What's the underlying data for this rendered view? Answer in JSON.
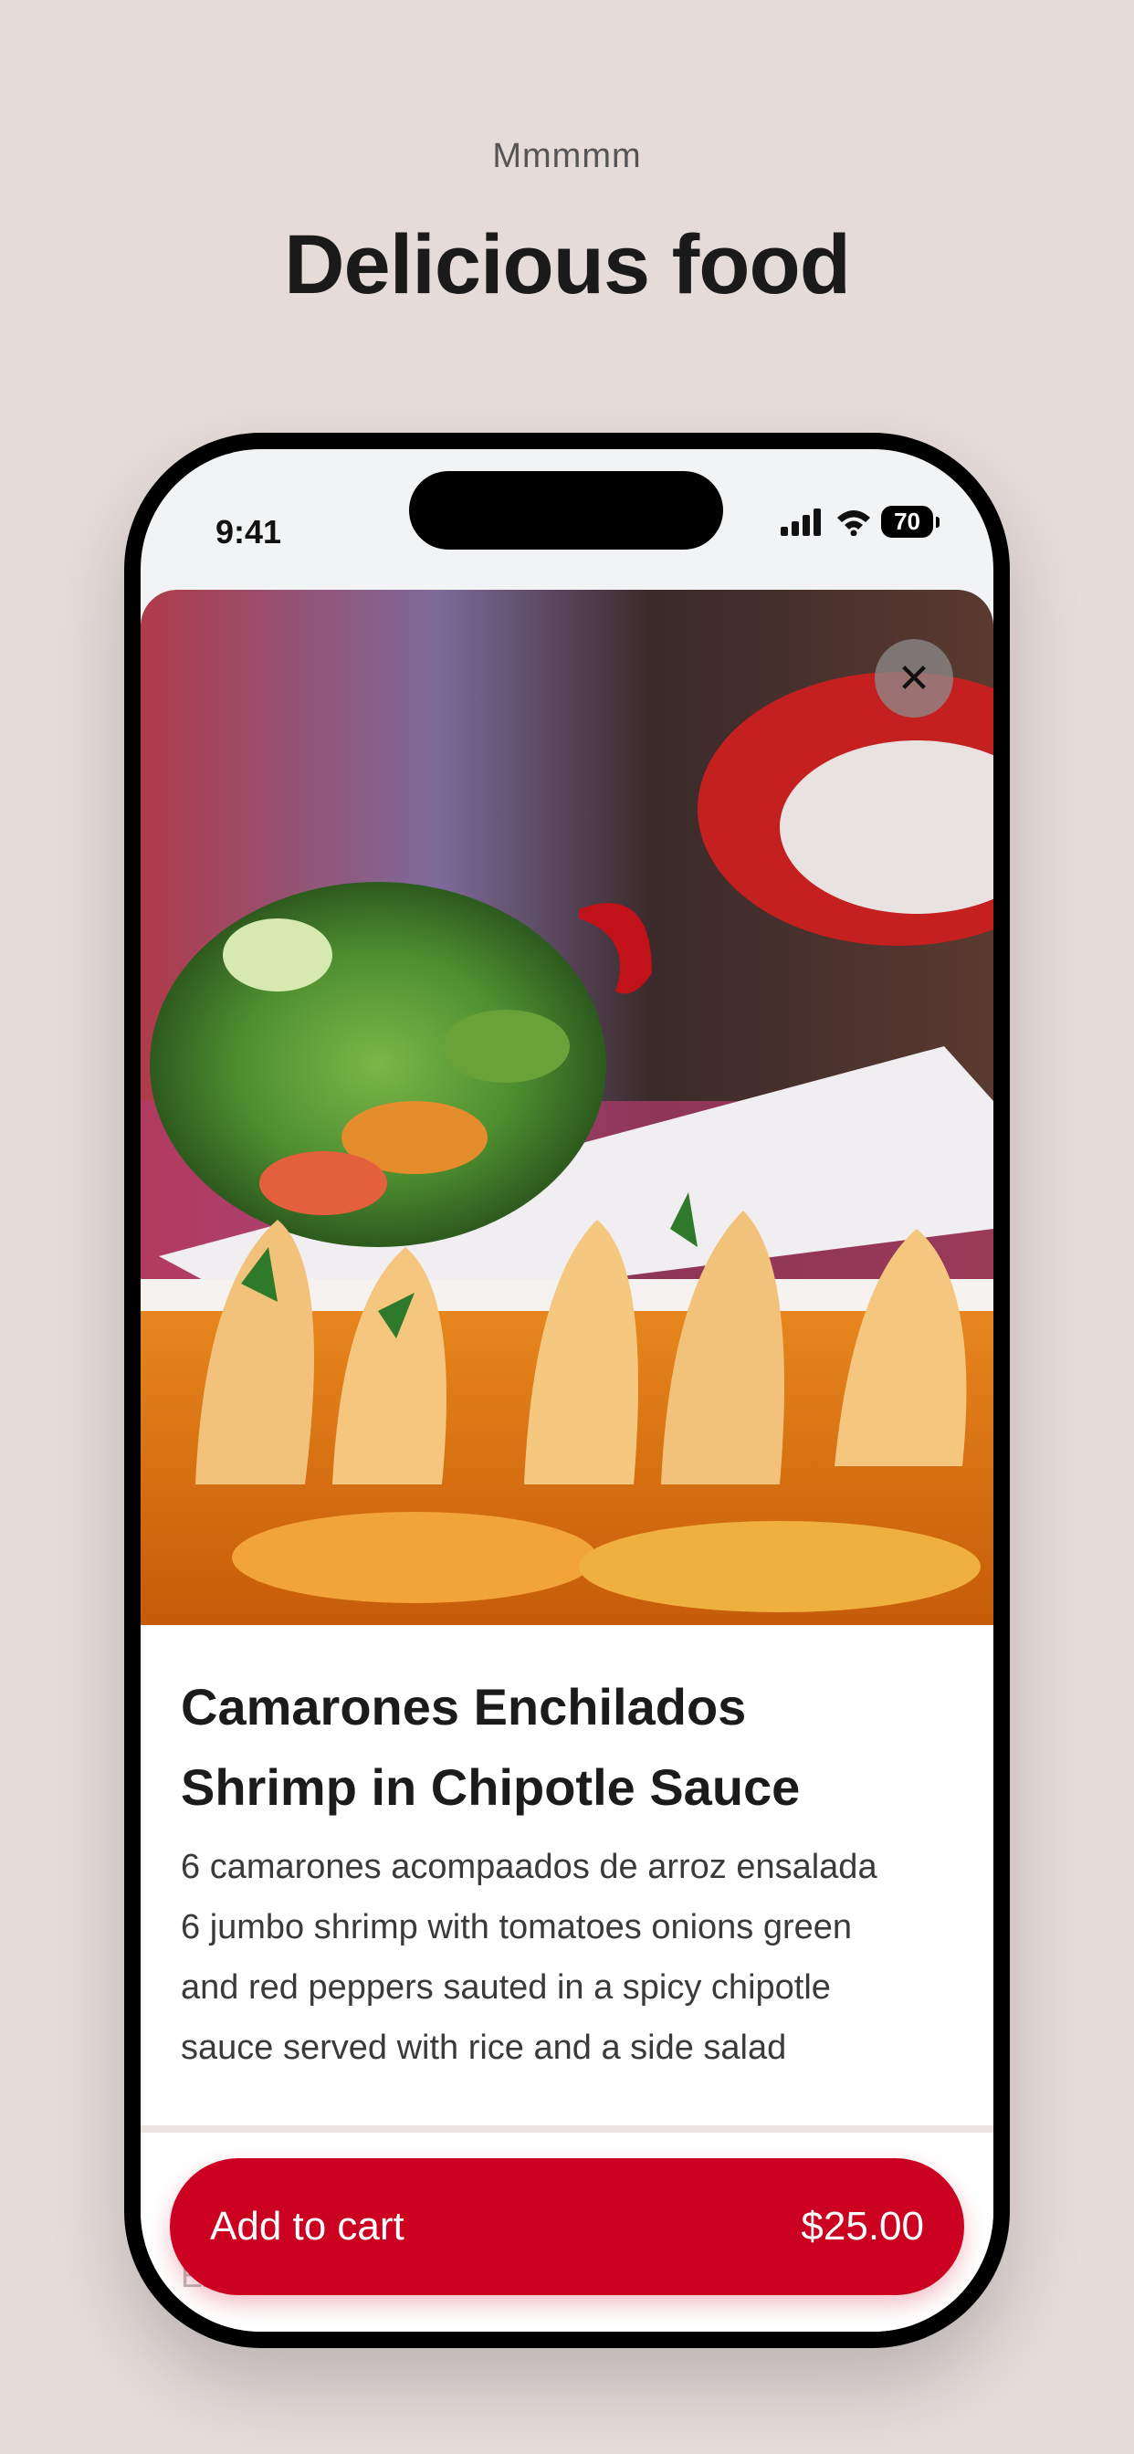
{
  "header": {
    "eyebrow": "Mmmmm",
    "title": "Delicious food"
  },
  "status_bar": {
    "time": "9:41",
    "battery": "70",
    "icons": [
      "signal-icon",
      "wifi-icon",
      "battery-icon"
    ]
  },
  "item": {
    "title_lines": [
      "Camarones Enchilados",
      "Shrimp in Chipotle Sauce"
    ],
    "description_lines": [
      "6 camarones acompaados de arroz ensalada",
      "6 jumbo shrimp with tomatoes onions green",
      "and red peppers sauted in a spicy chipotle",
      "sauce served with rice and a side salad"
    ],
    "hidden_text": "Extras"
  },
  "cart": {
    "label": "Add to cart",
    "price": "$25.00"
  },
  "colors": {
    "background": "#e5dcda",
    "accent": "#cc0020",
    "phone_frame": "#000000"
  }
}
